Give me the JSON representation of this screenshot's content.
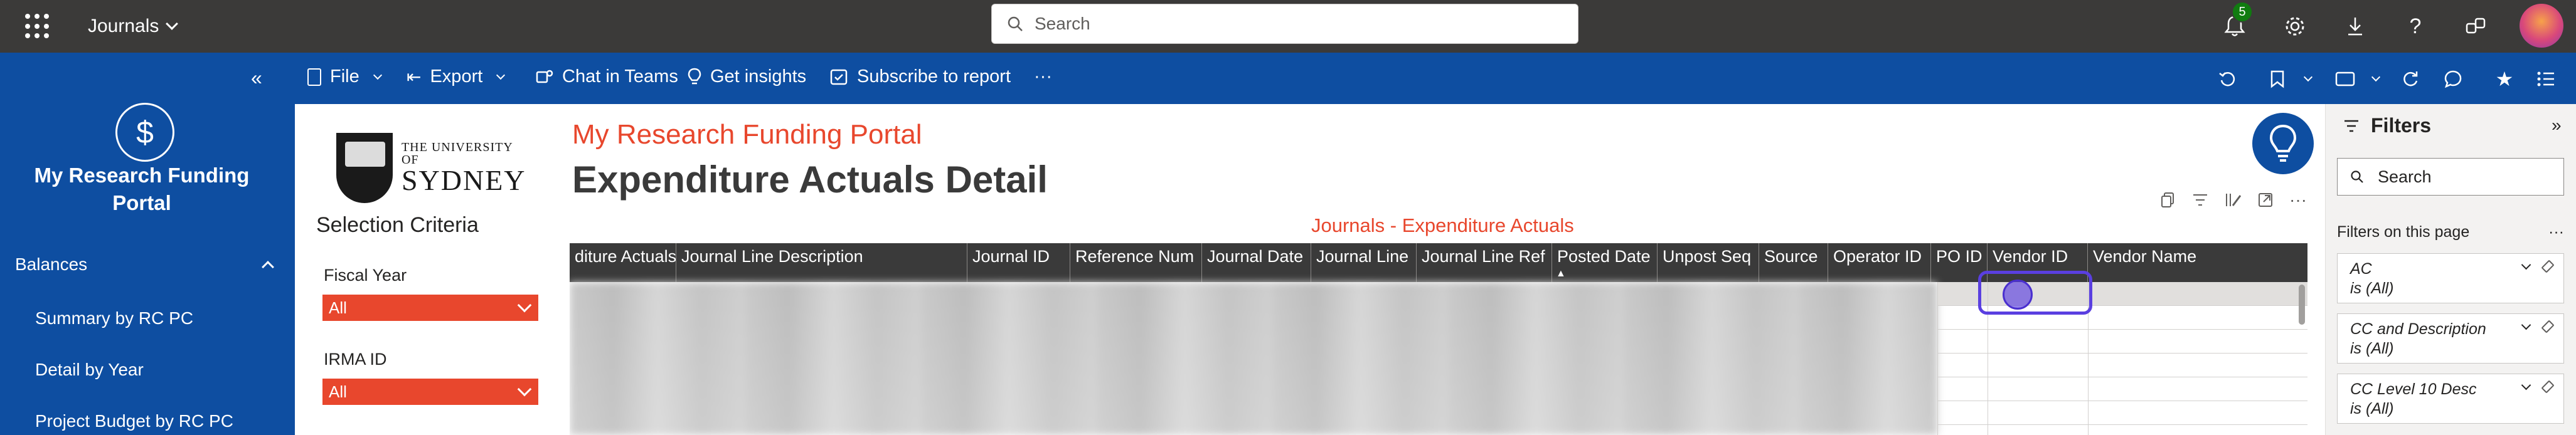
{
  "topbar": {
    "app_name": "Journals",
    "search_placeholder": "Search",
    "notification_count": "5",
    "icons": [
      "notifications-icon",
      "settings-icon",
      "download-icon",
      "help-icon",
      "share-icon",
      "avatar"
    ]
  },
  "leftnav": {
    "collapse": "«",
    "title": "My Research Funding Portal",
    "section": "Balances",
    "items": [
      {
        "label": "Summary by RC PC"
      },
      {
        "label": "Detail by Year"
      },
      {
        "label": "Project Budget by RC PC"
      }
    ]
  },
  "toolbar": {
    "file": "File",
    "export": "Export",
    "chat": "Chat in Teams",
    "insights": "Get insights",
    "subscribe": "Subscribe to report",
    "more": "···"
  },
  "report": {
    "logo_small": "THE UNIVERSITY OF",
    "logo_big": "SYDNEY",
    "selection_title": "Selection Criteria",
    "slicers": [
      {
        "label": "Fiscal Year",
        "value": "All"
      },
      {
        "label": "IRMA ID",
        "value": "All"
      }
    ],
    "portal_title": "My Research Funding Portal",
    "page_title": "Expenditure Actuals Detail",
    "table_title": "Journals - Expenditure Actuals",
    "columns": [
      "diture Actuals",
      "Journal Line Description",
      "Journal ID",
      "Reference Num",
      "Journal Date",
      "Journal Line",
      "Journal Line Ref",
      "Posted Date",
      "Unpost Seq",
      "Source",
      "Operator ID",
      "PO ID",
      "Vendor ID",
      "Vendor Name"
    ],
    "visual_more": "···"
  },
  "filters": {
    "title": "Filters",
    "collapse": "»",
    "search_placeholder": "Search",
    "on_page": "Filters on this page",
    "on_page_more": "···",
    "cards": [
      {
        "name": "AC",
        "value": "is (All)"
      },
      {
        "name": "CC and Description",
        "value": "is (All)"
      },
      {
        "name": "CC Level 10 Desc",
        "value": "is (All)"
      }
    ]
  },
  "colors": {
    "topbar": "#3b3a39",
    "brand_blue": "#0e4ea1",
    "accent_orange": "#e8472d",
    "table_header": "#3a3a3a",
    "cursor": "#5a3fe0"
  }
}
